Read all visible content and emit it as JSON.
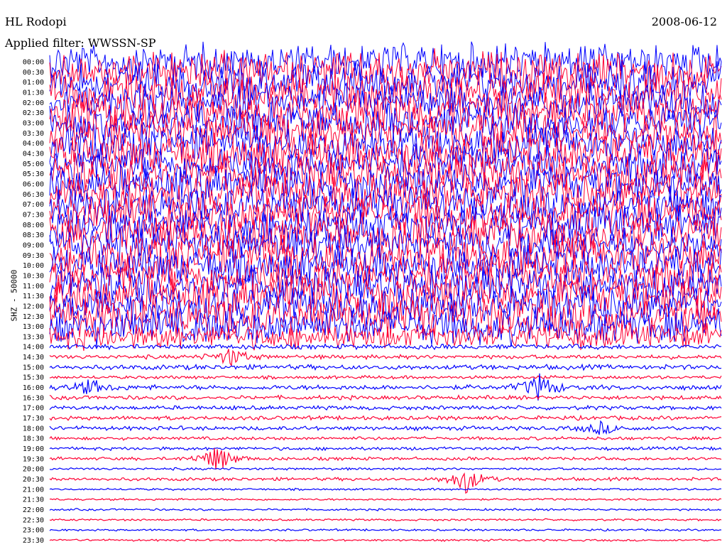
{
  "station": "HL Rodopi",
  "date": "2008-06-12",
  "filter_label": "Applied filter: WWSSN-SP",
  "colors": {
    "trace_a": "#0000ff",
    "trace_b": "#ff0033",
    "background": "#ffffff"
  },
  "chart_data": {
    "type": "line",
    "title": "HL Rodopi",
    "subtitle": "Applied filter: WWSSN-SP",
    "ylabel": "SHZ - 50000",
    "y_tick_labels": [
      "00:00",
      "00:30",
      "01:00",
      "01:30",
      "02:00",
      "02:30",
      "03:00",
      "03:30",
      "04:00",
      "04:30",
      "05:00",
      "05:30",
      "06:00",
      "06:30",
      "07:00",
      "07:30",
      "08:00",
      "08:30",
      "09:00",
      "09:30",
      "10:00",
      "10:30",
      "11:00",
      "11:30",
      "12:00",
      "12:30",
      "13:00",
      "13:30",
      "14:00",
      "14:30",
      "15:00",
      "15:30",
      "16:00",
      "16:30",
      "17:00",
      "17:30",
      "18:00",
      "18:30",
      "19:00",
      "19:30",
      "20:00",
      "20:30",
      "21:00",
      "21:30",
      "22:00",
      "22:30",
      "23:00",
      "23:30"
    ],
    "trace_colors_alternate": [
      "#0000ff",
      "#ff0033"
    ],
    "lines_per_row_minutes": 30,
    "grid": false,
    "row_noise_level": [
      0.9,
      1.0,
      0.9,
      1.0,
      0.9,
      1.0,
      0.9,
      1.0,
      0.9,
      1.0,
      0.9,
      1.0,
      0.9,
      1.0,
      0.9,
      1.0,
      0.9,
      1.0,
      0.9,
      1.0,
      0.9,
      1.0,
      0.9,
      1.0,
      0.9,
      1.0,
      0.9,
      0.6,
      0.12,
      0.1,
      0.12,
      0.08,
      0.12,
      0.1,
      0.1,
      0.1,
      0.1,
      0.08,
      0.08,
      0.08,
      0.06,
      0.08,
      0.05,
      0.05,
      0.05,
      0.05,
      0.05,
      0.05
    ],
    "events": [
      {
        "time": "14:30",
        "position": 0.27,
        "amplitude": 0.6
      },
      {
        "time": "16:00",
        "position": 0.06,
        "amplitude": 0.5
      },
      {
        "time": "16:00",
        "position": 0.73,
        "amplitude": 0.9
      },
      {
        "time": "19:30",
        "position": 0.25,
        "amplitude": 0.9
      },
      {
        "time": "20:30",
        "position": 0.62,
        "amplitude": 0.9
      },
      {
        "time": "18:00",
        "position": 0.82,
        "amplitude": 0.4
      }
    ]
  }
}
